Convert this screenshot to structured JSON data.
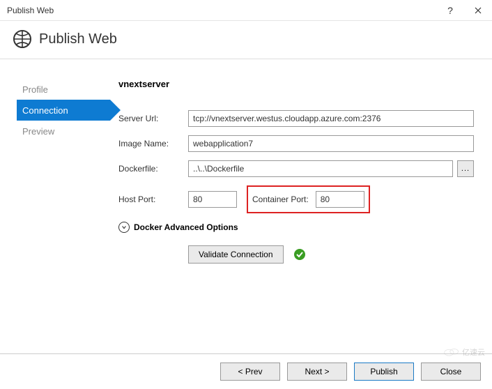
{
  "window": {
    "title": "Publish Web",
    "help": "?",
    "close": "×"
  },
  "header": {
    "title": "Publish Web"
  },
  "sidebar": {
    "items": [
      {
        "label": "Profile"
      },
      {
        "label": "Connection"
      },
      {
        "label": "Preview"
      }
    ],
    "activeIndex": 1
  },
  "form": {
    "heading": "vnextserver",
    "serverUrl": {
      "label": "Server Url:",
      "value": "tcp://vnextserver.westus.cloudapp.azure.com:2376"
    },
    "imageName": {
      "label": "Image Name:",
      "value": "webapplication7"
    },
    "dockerfile": {
      "label": "Dockerfile:",
      "value": "..\\..\\Dockerfile",
      "browse": "..."
    },
    "hostPort": {
      "label": "Host Port:",
      "value": "80"
    },
    "containerPort": {
      "label": "Container Port:",
      "value": "80"
    },
    "advanced": "Docker Advanced Options",
    "validate": "Validate Connection"
  },
  "footer": {
    "prev": "< Prev",
    "next": "Next >",
    "publish": "Publish",
    "close": "Close"
  },
  "watermark": "亿速云"
}
